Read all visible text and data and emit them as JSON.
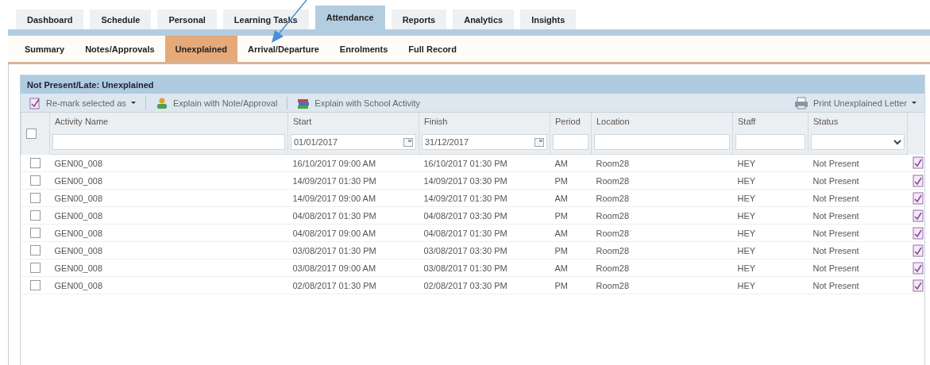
{
  "top_tabs": [
    {
      "label": "Dashboard",
      "selected": false
    },
    {
      "label": "Schedule",
      "selected": false
    },
    {
      "label": "Personal",
      "selected": false
    },
    {
      "label": "Learning Tasks",
      "selected": false
    },
    {
      "label": "Attendance",
      "selected": true
    },
    {
      "label": "Reports",
      "selected": false
    },
    {
      "label": "Analytics",
      "selected": false
    },
    {
      "label": "Insights",
      "selected": false
    }
  ],
  "sub_tabs": [
    {
      "label": "Summary",
      "selected": false
    },
    {
      "label": "Notes/Approvals",
      "selected": false
    },
    {
      "label": "Unexplained",
      "selected": true
    },
    {
      "label": "Arrival/Departure",
      "selected": false
    },
    {
      "label": "Enrolments",
      "selected": false
    },
    {
      "label": "Full Record",
      "selected": false
    }
  ],
  "panel": {
    "title": "Not Present/Late: Unexplained",
    "toolbar_left": [
      {
        "label": "Re-mark selected as",
        "dropdown": true
      },
      {
        "label": "Explain with Note/Approval",
        "dropdown": false
      },
      {
        "label": "Explain with School Activity",
        "dropdown": false
      }
    ],
    "toolbar_right": [
      {
        "label": "Print Unexplained Letter",
        "dropdown": true
      }
    ]
  },
  "table": {
    "select_all_checked": false,
    "columns": [
      {
        "label": "Activity Name",
        "kind": "text"
      },
      {
        "label": "Start",
        "kind": "date",
        "filter_value": "01/01/2017"
      },
      {
        "label": "Finish",
        "kind": "date",
        "filter_value": "31/12/2017"
      },
      {
        "label": "Period",
        "kind": "text"
      },
      {
        "label": "Location",
        "kind": "text"
      },
      {
        "label": "Staff",
        "kind": "text"
      },
      {
        "label": "Status",
        "kind": "select"
      }
    ],
    "rows": [
      {
        "checked": false,
        "cells": [
          "GEN00_008",
          "16/10/2017 09:00 AM",
          "16/10/2017 01:30 PM",
          "AM",
          "Room28",
          "HEY",
          "Not Present"
        ]
      },
      {
        "checked": false,
        "cells": [
          "GEN00_008",
          "14/09/2017 01:30 PM",
          "14/09/2017 03:30 PM",
          "PM",
          "Room28",
          "HEY",
          "Not Present"
        ]
      },
      {
        "checked": false,
        "cells": [
          "GEN00_008",
          "14/09/2017 09:00 AM",
          "14/09/2017 01:30 PM",
          "AM",
          "Room28",
          "HEY",
          "Not Present"
        ]
      },
      {
        "checked": false,
        "cells": [
          "GEN00_008",
          "04/08/2017 01:30 PM",
          "04/08/2017 03:30 PM",
          "PM",
          "Room28",
          "HEY",
          "Not Present"
        ]
      },
      {
        "checked": false,
        "cells": [
          "GEN00_008",
          "04/08/2017 09:00 AM",
          "04/08/2017 01:30 PM",
          "AM",
          "Room28",
          "HEY",
          "Not Present"
        ]
      },
      {
        "checked": false,
        "cells": [
          "GEN00_008",
          "03/08/2017 01:30 PM",
          "03/08/2017 03:30 PM",
          "PM",
          "Room28",
          "HEY",
          "Not Present"
        ]
      },
      {
        "checked": false,
        "cells": [
          "GEN00_008",
          "03/08/2017 09:00 AM",
          "03/08/2017 01:30 PM",
          "AM",
          "Room28",
          "HEY",
          "Not Present"
        ]
      },
      {
        "checked": false,
        "cells": [
          "GEN00_008",
          "02/08/2017 01:30 PM",
          "02/08/2017 03:30 PM",
          "PM",
          "Room28",
          "HEY",
          "Not Present"
        ]
      }
    ]
  }
}
